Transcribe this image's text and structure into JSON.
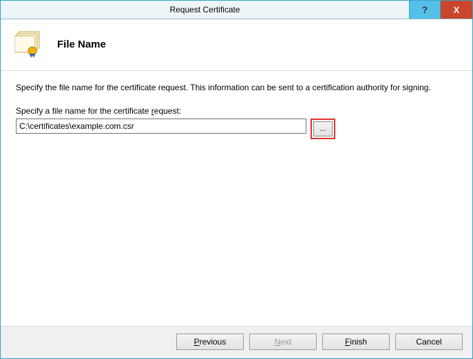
{
  "titlebar": {
    "title": "Request Certificate",
    "help_label": "?",
    "close_label": "X"
  },
  "header": {
    "title": "File Name"
  },
  "content": {
    "description": "Specify the file name for the certificate request. This information can be sent to a certification authority for signing.",
    "field_label_pre": "Specify a file name for the certificate ",
    "field_label_key": "r",
    "field_label_post": "equest:",
    "file_path": "C:\\certificates\\example.com.csr",
    "browse_label": "..."
  },
  "footer": {
    "previous_key": "P",
    "previous_rest": "revious",
    "next_key": "N",
    "next_rest": "ext",
    "finish_key": "F",
    "finish_rest": "inish",
    "cancel": "Cancel"
  }
}
